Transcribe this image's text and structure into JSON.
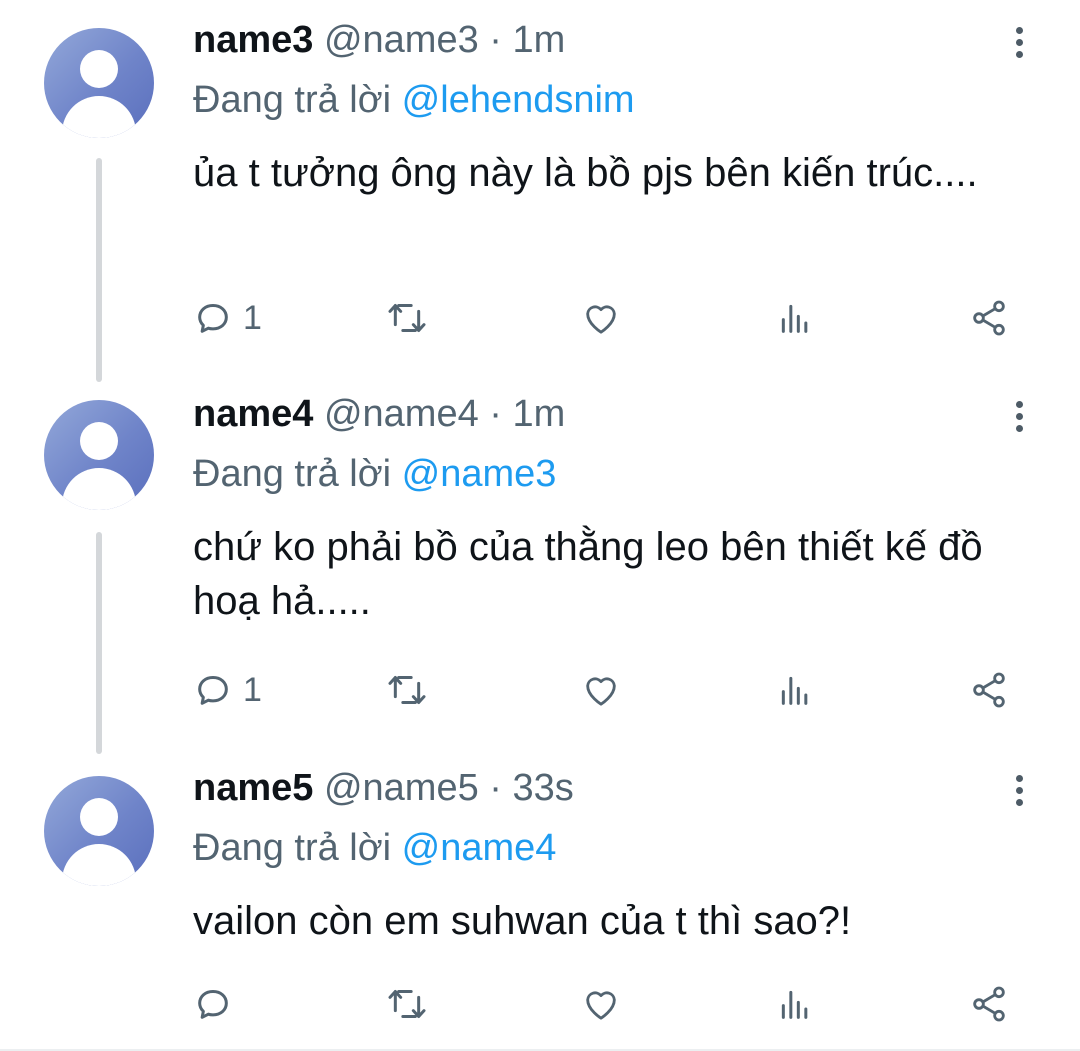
{
  "tweets": [
    {
      "name": "name3",
      "handle": "@name3",
      "sep": "·",
      "time": "1m",
      "reply_prefix": "Đang trả lời",
      "reply_to": "@lehendsnim",
      "text": "ủa t tưởng ông này là bồ pjs bên kiến trúc....",
      "reply_count": "1"
    },
    {
      "name": "name4",
      "handle": "@name4",
      "sep": "·",
      "time": "1m",
      "reply_prefix": "Đang trả lời",
      "reply_to": "@name3",
      "text": "chứ ko phải bồ của thằng leo bên thiết kế đồ hoạ hả.....",
      "reply_count": "1"
    },
    {
      "name": "name5",
      "handle": "@name5",
      "sep": "·",
      "time": "33s",
      "reply_prefix": "Đang trả lời",
      "reply_to": "@name4",
      "text": "vailon còn em suhwan của t thì sao?!",
      "reply_count": ""
    }
  ],
  "icons": {
    "reply": "reply-icon",
    "retweet": "retweet-icon",
    "like": "heart-icon",
    "views": "views-icon",
    "share": "share-icon",
    "more": "more-icon"
  },
  "colors": {
    "link": "#1d9bf0",
    "secondary_text": "#536471",
    "primary_text": "#0f1419",
    "avatar": "#6f84c9",
    "thread_line": "#d4d7da"
  }
}
